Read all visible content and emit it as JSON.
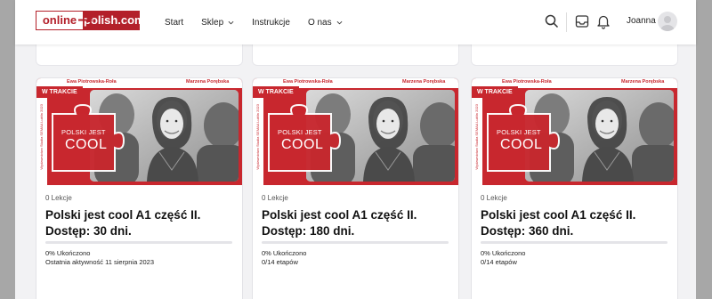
{
  "header": {
    "logo_left": "online",
    "logo_right": "polish.com",
    "nav": [
      {
        "label": "Start",
        "dropdown": false
      },
      {
        "label": "Sklep",
        "dropdown": true
      },
      {
        "label": "Instrukcje",
        "dropdown": false
      },
      {
        "label": "O nas",
        "dropdown": true
      }
    ],
    "icons": [
      "search-icon",
      "inbox-icon",
      "bell-icon"
    ],
    "user_name": "Joanna"
  },
  "cover": {
    "author_left": "Ewa Piotrowska-Roła",
    "author_right": "Marzena Porębska",
    "side_text": "Wydawnictwo Studia SEMAA Lublin 2023",
    "badge": "W TRAKCIE",
    "puzzle_line1": "POLSKI JEST",
    "puzzle_line2": "COOL"
  },
  "colors": {
    "accent": "#c8272e",
    "brand": "#b3202a"
  },
  "cards": [
    {
      "lessons": "0 Lekcje",
      "title": "Polski jest cool A1 część II. Dostęp: 30 dni.",
      "progress_value": 0,
      "progress": "0% Ukończono",
      "sub": "Ostatnia aktywność 11 sierpnia 2023"
    },
    {
      "lessons": "0 Lekcje",
      "title": "Polski jest cool A1 część II. Dostęp: 180 dni.",
      "progress_value": 0,
      "progress": "0% Ukończono",
      "sub": "0/14 etapów"
    },
    {
      "lessons": "0 Lekcje",
      "title": "Polski jest cool A1 część II. Dostęp: 360 dni.",
      "progress_value": 0,
      "progress": "0% Ukończono",
      "sub": "0/14 etapów"
    }
  ]
}
